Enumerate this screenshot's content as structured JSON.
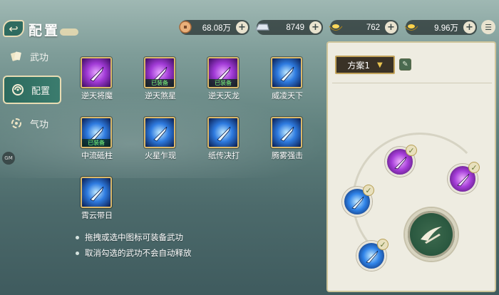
{
  "header": {
    "title": "配置",
    "resources": [
      {
        "icon": "copper-coin-icon",
        "value": "68.08万"
      },
      {
        "icon": "silver-ingot-icon",
        "value": "8749"
      },
      {
        "icon": "gold-ingot-icon",
        "value": "762"
      },
      {
        "icon": "gold-ingot-large-icon",
        "value": "9.96万"
      }
    ],
    "plus_symbol": "+"
  },
  "nav": {
    "items": [
      {
        "label": "武功",
        "icon": "cards-icon",
        "active": false
      },
      {
        "label": "配置",
        "icon": "swirl-icon",
        "active": true
      },
      {
        "label": "气功",
        "icon": "qi-icon",
        "active": false
      }
    ],
    "gm_label": "GM"
  },
  "skills": [
    {
      "name": "逆天将魔",
      "color": "purple",
      "equipped": false
    },
    {
      "name": "逆天煞星",
      "color": "purple",
      "equipped": true
    },
    {
      "name": "逆天灭龙",
      "color": "purple",
      "equipped": true
    },
    {
      "name": "威凌天下",
      "color": "blue",
      "equipped": false
    },
    {
      "name": "中流砥柱",
      "color": "blue",
      "equipped": true
    },
    {
      "name": "火星乍现",
      "color": "blue",
      "equipped": false
    },
    {
      "name": "纸传决打",
      "color": "blue",
      "equipped": false
    },
    {
      "name": "腾雾强击",
      "color": "blue",
      "equipped": false
    },
    {
      "name": "霄云带日",
      "color": "blue",
      "equipped": false
    }
  ],
  "equipped_badge": "已装备",
  "tips": [
    "拖拽或选中图标可装备武功",
    "取消勾选的武功不会自动释放"
  ],
  "plan": {
    "selected": "方案1"
  },
  "slots": [
    {
      "color": "purple",
      "checked": true
    },
    {
      "color": "purple",
      "checked": true
    },
    {
      "color": "blue",
      "checked": true
    },
    {
      "color": "blue",
      "checked": true
    }
  ],
  "colors": {
    "accent_gold": "#d9b86a",
    "panel_bg": "#eeece1",
    "nav_active": "#2c6a5e",
    "equipped_text": "#7cff7c"
  }
}
